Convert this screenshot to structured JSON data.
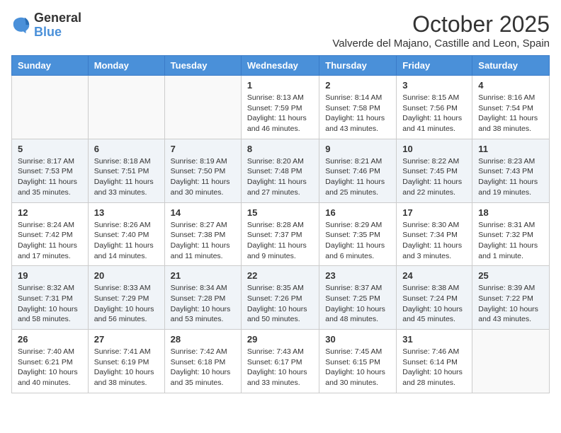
{
  "logo": {
    "general": "General",
    "blue": "Blue"
  },
  "header": {
    "month": "October 2025",
    "location": "Valverde del Majano, Castille and Leon, Spain"
  },
  "weekdays": [
    "Sunday",
    "Monday",
    "Tuesday",
    "Wednesday",
    "Thursday",
    "Friday",
    "Saturday"
  ],
  "weeks": [
    [
      {
        "day": "",
        "info": ""
      },
      {
        "day": "",
        "info": ""
      },
      {
        "day": "",
        "info": ""
      },
      {
        "day": "1",
        "info": "Sunrise: 8:13 AM\nSunset: 7:59 PM\nDaylight: 11 hours and 46 minutes."
      },
      {
        "day": "2",
        "info": "Sunrise: 8:14 AM\nSunset: 7:58 PM\nDaylight: 11 hours and 43 minutes."
      },
      {
        "day": "3",
        "info": "Sunrise: 8:15 AM\nSunset: 7:56 PM\nDaylight: 11 hours and 41 minutes."
      },
      {
        "day": "4",
        "info": "Sunrise: 8:16 AM\nSunset: 7:54 PM\nDaylight: 11 hours and 38 minutes."
      }
    ],
    [
      {
        "day": "5",
        "info": "Sunrise: 8:17 AM\nSunset: 7:53 PM\nDaylight: 11 hours and 35 minutes."
      },
      {
        "day": "6",
        "info": "Sunrise: 8:18 AM\nSunset: 7:51 PM\nDaylight: 11 hours and 33 minutes."
      },
      {
        "day": "7",
        "info": "Sunrise: 8:19 AM\nSunset: 7:50 PM\nDaylight: 11 hours and 30 minutes."
      },
      {
        "day": "8",
        "info": "Sunrise: 8:20 AM\nSunset: 7:48 PM\nDaylight: 11 hours and 27 minutes."
      },
      {
        "day": "9",
        "info": "Sunrise: 8:21 AM\nSunset: 7:46 PM\nDaylight: 11 hours and 25 minutes."
      },
      {
        "day": "10",
        "info": "Sunrise: 8:22 AM\nSunset: 7:45 PM\nDaylight: 11 hours and 22 minutes."
      },
      {
        "day": "11",
        "info": "Sunrise: 8:23 AM\nSunset: 7:43 PM\nDaylight: 11 hours and 19 minutes."
      }
    ],
    [
      {
        "day": "12",
        "info": "Sunrise: 8:24 AM\nSunset: 7:42 PM\nDaylight: 11 hours and 17 minutes."
      },
      {
        "day": "13",
        "info": "Sunrise: 8:26 AM\nSunset: 7:40 PM\nDaylight: 11 hours and 14 minutes."
      },
      {
        "day": "14",
        "info": "Sunrise: 8:27 AM\nSunset: 7:38 PM\nDaylight: 11 hours and 11 minutes."
      },
      {
        "day": "15",
        "info": "Sunrise: 8:28 AM\nSunset: 7:37 PM\nDaylight: 11 hours and 9 minutes."
      },
      {
        "day": "16",
        "info": "Sunrise: 8:29 AM\nSunset: 7:35 PM\nDaylight: 11 hours and 6 minutes."
      },
      {
        "day": "17",
        "info": "Sunrise: 8:30 AM\nSunset: 7:34 PM\nDaylight: 11 hours and 3 minutes."
      },
      {
        "day": "18",
        "info": "Sunrise: 8:31 AM\nSunset: 7:32 PM\nDaylight: 11 hours and 1 minute."
      }
    ],
    [
      {
        "day": "19",
        "info": "Sunrise: 8:32 AM\nSunset: 7:31 PM\nDaylight: 10 hours and 58 minutes."
      },
      {
        "day": "20",
        "info": "Sunrise: 8:33 AM\nSunset: 7:29 PM\nDaylight: 10 hours and 56 minutes."
      },
      {
        "day": "21",
        "info": "Sunrise: 8:34 AM\nSunset: 7:28 PM\nDaylight: 10 hours and 53 minutes."
      },
      {
        "day": "22",
        "info": "Sunrise: 8:35 AM\nSunset: 7:26 PM\nDaylight: 10 hours and 50 minutes."
      },
      {
        "day": "23",
        "info": "Sunrise: 8:37 AM\nSunset: 7:25 PM\nDaylight: 10 hours and 48 minutes."
      },
      {
        "day": "24",
        "info": "Sunrise: 8:38 AM\nSunset: 7:24 PM\nDaylight: 10 hours and 45 minutes."
      },
      {
        "day": "25",
        "info": "Sunrise: 8:39 AM\nSunset: 7:22 PM\nDaylight: 10 hours and 43 minutes."
      }
    ],
    [
      {
        "day": "26",
        "info": "Sunrise: 7:40 AM\nSunset: 6:21 PM\nDaylight: 10 hours and 40 minutes."
      },
      {
        "day": "27",
        "info": "Sunrise: 7:41 AM\nSunset: 6:19 PM\nDaylight: 10 hours and 38 minutes."
      },
      {
        "day": "28",
        "info": "Sunrise: 7:42 AM\nSunset: 6:18 PM\nDaylight: 10 hours and 35 minutes."
      },
      {
        "day": "29",
        "info": "Sunrise: 7:43 AM\nSunset: 6:17 PM\nDaylight: 10 hours and 33 minutes."
      },
      {
        "day": "30",
        "info": "Sunrise: 7:45 AM\nSunset: 6:15 PM\nDaylight: 10 hours and 30 minutes."
      },
      {
        "day": "31",
        "info": "Sunrise: 7:46 AM\nSunset: 6:14 PM\nDaylight: 10 hours and 28 minutes."
      },
      {
        "day": "",
        "info": ""
      }
    ]
  ]
}
